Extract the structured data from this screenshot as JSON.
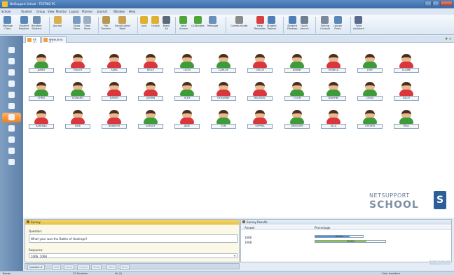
{
  "window": {
    "title": "NetSupport School - TESTING PC"
  },
  "menu": [
    "School",
    "Student",
    "Group",
    "View",
    "Monitor",
    "Layout",
    "Planner",
    "Journal",
    "Window",
    "Help"
  ],
  "ribbon": [
    {
      "label": "Manage\nClass",
      "icon": "manage-class-icon"
    },
    {
      "label": "Student\nRegister",
      "icon": "student-register-icon"
    },
    {
      "label": "Random\nStudent",
      "icon": "random-student-icon"
    },
    {
      "label": "Journal",
      "icon": "journal-icon"
    },
    {
      "label": "Show\nMenu",
      "icon": "show-icon"
    },
    {
      "label": "View\nShow",
      "icon": "view-icon"
    },
    {
      "label": "File\nTransfer",
      "icon": "file-transfer-icon"
    },
    {
      "label": "Send/Collect\nWork",
      "icon": "send-collect-icon"
    },
    {
      "label": "Lock",
      "icon": "lock-icon"
    },
    {
      "label": "Unlock",
      "icon": "unlock-icon"
    },
    {
      "label": "Blank\nAll",
      "icon": "blank-icon"
    },
    {
      "label": "Web\nAccess",
      "icon": "web-icon"
    },
    {
      "label": "Co-Browse",
      "icon": "co-browse-icon"
    },
    {
      "label": "Message",
      "icon": "message-icon"
    },
    {
      "label": "Communicate",
      "icon": "communicate-icon"
    },
    {
      "label": "Help\nRequests",
      "icon": "help-icon"
    },
    {
      "label": "Student\nToolbar",
      "icon": "student-toolbar-icon"
    },
    {
      "label": "Student\nDesktop",
      "icon": "desktop-icon"
    },
    {
      "label": "Quick\nLaunch",
      "icon": "quick-launch-icon"
    },
    {
      "label": "Testing\nConsole",
      "icon": "testing-icon"
    },
    {
      "label": "Lesson\nPlans",
      "icon": "lesson-plans-icon"
    },
    {
      "label": "Tutor\nAssistant",
      "icon": "tutor-assistant-icon"
    }
  ],
  "tabs": [
    {
      "label": "All (1)"
    },
    {
      "label": "www.arvo (1)"
    }
  ],
  "students": [
    {
      "name": "JAMES",
      "g": "m"
    },
    {
      "name": "TRACEY",
      "g": "f"
    },
    {
      "name": "SARA",
      "g": "f"
    },
    {
      "name": "KELLY",
      "g": "f"
    },
    {
      "name": "LEON",
      "g": "m"
    },
    {
      "name": "CARLOS",
      "g": "m"
    },
    {
      "name": "CHLOE",
      "g": "f"
    },
    {
      "name": "DANNY",
      "g": "m"
    },
    {
      "name": "MONICA",
      "g": "f"
    },
    {
      "name": "JOEY",
      "g": "m"
    },
    {
      "name": "CLAIRE",
      "g": "f"
    },
    {
      "name": "CHRIS",
      "g": "m"
    },
    {
      "name": "EDWARD",
      "g": "m"
    },
    {
      "name": "KAREN",
      "g": "f"
    },
    {
      "name": "JASMIN",
      "g": "f"
    },
    {
      "name": "ALEX",
      "g": "m"
    },
    {
      "name": "ROXANNE",
      "g": "f"
    },
    {
      "name": "RACHAEL",
      "g": "f"
    },
    {
      "name": "COLIN",
      "g": "m"
    },
    {
      "name": "DWAYNE",
      "g": "m"
    },
    {
      "name": "DEAN",
      "g": "m"
    },
    {
      "name": "SALLY",
      "g": "f"
    },
    {
      "name": "KARIANA",
      "g": "f"
    },
    {
      "name": "FAYE",
      "g": "f"
    },
    {
      "name": "JENNIFER",
      "g": "f"
    },
    {
      "name": "ASHLEY",
      "g": "m"
    },
    {
      "name": "JADE",
      "g": "f"
    },
    {
      "name": "TOM",
      "g": "m"
    },
    {
      "name": "SOPHIA",
      "g": "f"
    },
    {
      "name": "GREGORY",
      "g": "m"
    },
    {
      "name": "ELLA",
      "g": "f"
    },
    {
      "name": "STEVEN",
      "g": "m"
    },
    {
      "name": "PAUL",
      "g": "m"
    }
  ],
  "logo": {
    "line1": "NETSUPPORT",
    "line2": "SCHOOL",
    "mark": "S"
  },
  "survey": {
    "title": "Survey",
    "question_label": "Question:",
    "question": "What year was the Battle of Hastings?",
    "response_label": "Response:",
    "response": "1066, 1068"
  },
  "results": {
    "title": "Survey Results",
    "col_answer": "Answer",
    "col_percentage": "Percentage",
    "rows": [
      {
        "answer": "1066",
        "pct_label": "30.0%",
        "pct": 30,
        "color": "#4f8fd4"
      },
      {
        "answer": "1068",
        "pct_label": "70.0%",
        "pct": 70,
        "color": "#8cc63e"
      }
    ]
  },
  "bottom_toolbar": [
    "Question ▾",
    "Add",
    "Send",
    "Cancel",
    "Show",
    "View",
    "Print"
  ],
  "brand_footer": [
    "Student Survey List",
    "NetSupport School"
  ],
  "status": {
    "ready": "Ready",
    "students": "33 Students",
    "class": "All (1)",
    "tutor": "Tutor Assistant"
  }
}
